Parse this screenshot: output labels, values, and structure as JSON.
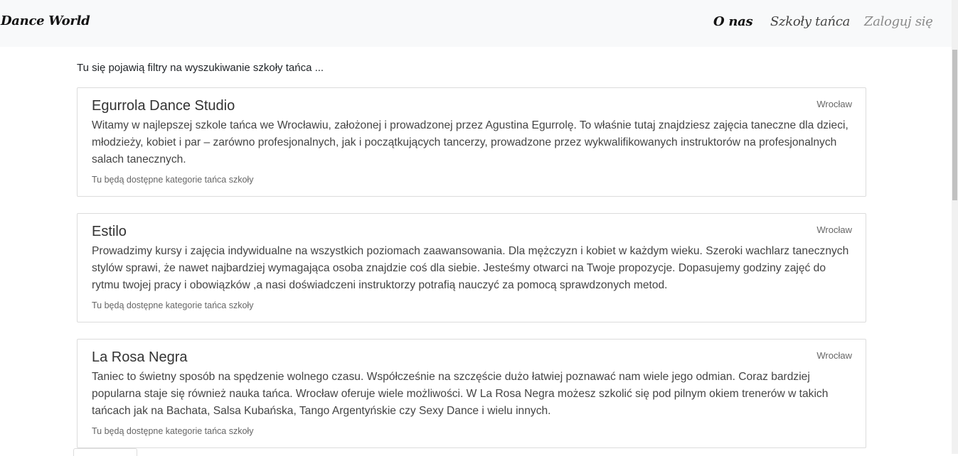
{
  "navbar": {
    "brand": "Dance World",
    "links": [
      {
        "label": "O nas"
      },
      {
        "label": "Szkoły tańca"
      },
      {
        "label": "Zaloguj się"
      }
    ]
  },
  "filters_note": "Tu się pojawią filtry na wyszukiwanie szkoły tańca ...",
  "schools": [
    {
      "name": "Egurrola Dance Studio",
      "city": "Wrocław",
      "description": "Witamy w najlepszej szkole tańca we Wrocławiu, założonej i prowadzonej przez Agustina Egurrolę. To właśnie tutaj znajdziesz zajęcia taneczne dla dzieci, młodzieży, kobiet i par – zarówno profesjonalnych, jak i początkujących tancerzy, prowadzone przez wykwalifikowanych instruktorów na profesjonalnych salach tanecznych.",
      "categories": "Tu będą dostępne kategorie tańca szkoły"
    },
    {
      "name": "Estilo",
      "city": "Wrocław",
      "description": "Prowadzimy kursy i zajęcia indywidualne na wszystkich poziomach zaawansowania. Dla mężczyzn i kobiet w każdym wieku. Szeroki wachlarz tanecznych stylów sprawi, że nawet najbardziej wymagająca osoba znajdzie coś dla siebie. Jesteśmy otwarci na Twoje propozycje. Dopasujemy godziny zajęć do rytmu twojej pracy i obowiązków ,a nasi doświadczeni instruktorzy potrafią nauczyć za pomocą sprawdzonych metod.",
      "categories": "Tu będą dostępne kategorie tańca szkoły"
    },
    {
      "name": "La Rosa Negra",
      "city": "Wrocław",
      "description": "Taniec to świetny sposób na spędzenie wolnego czasu. Współcześnie na szczęście dużo łatwiej poznawać nam wiele jego odmian. Coraz bardziej popularna staje się również nauka tańca. Wrocław oferuje wiele możliwości. W La Rosa Negra możesz szkolić się pod pilnym okiem trenerów w takich tańcach jak na Bachata, Salsa Kubańska, Tango Argentyńskie czy Sexy Dance i wielu innych.",
      "categories": "Tu będą dostępne kategorie tańca szkoły"
    }
  ]
}
